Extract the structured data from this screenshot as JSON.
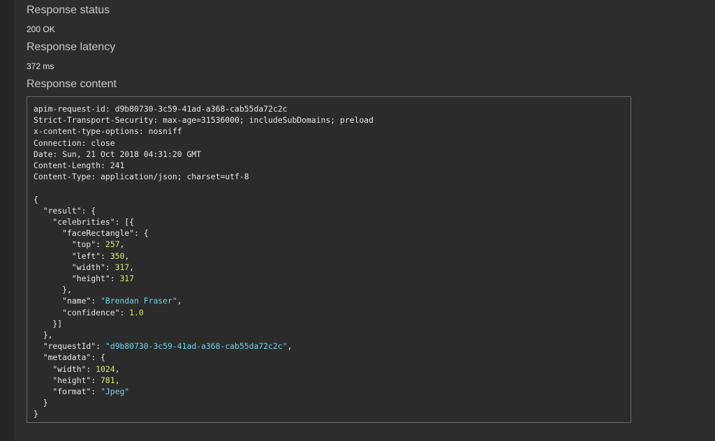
{
  "response_status": {
    "heading": "Response status",
    "value": "200 OK"
  },
  "response_latency": {
    "heading": "Response latency",
    "value": "372 ms"
  },
  "response_content": {
    "heading": "Response content",
    "headers": [
      "apim-request-id: d9b80730-3c59-41ad-a368-cab55da72c2c",
      "Strict-Transport-Security: max-age=31536000; includeSubDomains; preload",
      "x-content-type-options: nosniff",
      "Connection: close",
      "Date: Sun, 21 Oct 2018 04:31:20 GMT",
      "Content-Length: 241",
      "Content-Type: application/json; charset=utf-8"
    ],
    "body": {
      "face_top": "257",
      "face_left": "350",
      "face_width": "317",
      "face_height": "317",
      "name": "\"Brendan Fraser\"",
      "confidence": "1.0",
      "request_id": "\"d9b80730-3c59-41ad-a368-cab55da72c2c\"",
      "meta_width": "1024",
      "meta_height": "781",
      "meta_format": "\"Jpeg\""
    }
  },
  "colors": {
    "string": "#6fd6e4",
    "number": "#dfe87a",
    "background": "#2b2b2b"
  }
}
